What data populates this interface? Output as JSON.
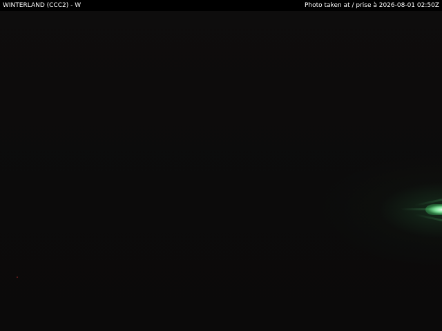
{
  "banner": {
    "station": "WINTERLAND (CCC2) - W",
    "timestamp": "Photo taken at / prise à 2026-08-01 02:50Z"
  },
  "colors": {
    "banner_background": "#000000",
    "banner_text": "#ffffff",
    "sky": "#0d0c0c",
    "light_glow": "#7fe39a"
  }
}
